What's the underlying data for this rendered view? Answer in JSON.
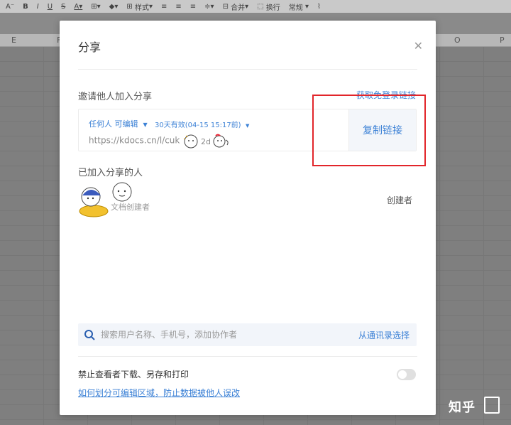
{
  "toolbar": {
    "items": [
      "A",
      "B",
      "I",
      "U",
      "S",
      "A",
      "⊞",
      "◆",
      "⊞ 样式",
      "≡",
      "≡",
      "≡",
      "≑",
      "⊟ 合并",
      "⬚ 换行",
      "常规",
      "⌇"
    ],
    "merge_label": "合并",
    "wrap_label": "换行",
    "style_label": "样式",
    "format_label": "常规"
  },
  "columns": [
    "E",
    "F",
    "O",
    "P"
  ],
  "dialog": {
    "title": "分享",
    "close_icon": "close-icon",
    "invite_label": "邀请他人加入分享",
    "login_free_link": "获取免登录链接",
    "permission": "任何人 可编辑",
    "expiry": "30天有效(04-15 15:17前)",
    "url": "https://kdocs.cn/l/cuk",
    "url_tail": "2d",
    "copy_button": "复制链接",
    "joined_label": "已加入分享的人",
    "member": {
      "name": "",
      "subtitle": "文档创建者",
      "role": "创建者"
    },
    "search": {
      "placeholder": "搜索用户名称、手机号，添加协作者",
      "contacts_link": "从通讯录选择"
    },
    "forbid_label": "禁止查看者下载、另存和打印",
    "help_link": "如何划分可编辑区域，防止数据被他人误改",
    "toggle_on": false
  },
  "watermark": "知乎",
  "colors": {
    "accent": "#3d82d6",
    "highlight": "#e2252a",
    "overlay": "#7e7e7e"
  }
}
